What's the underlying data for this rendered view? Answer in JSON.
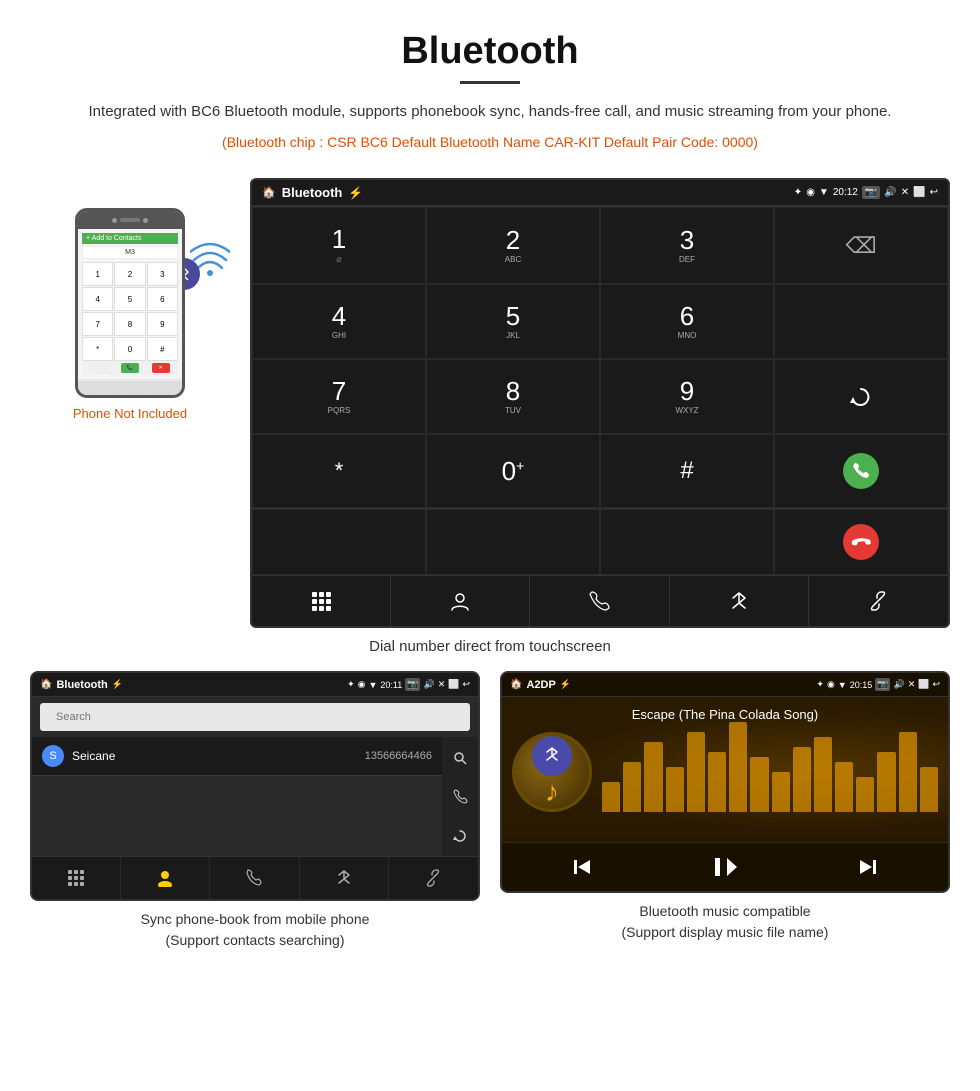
{
  "header": {
    "title": "Bluetooth",
    "description": "Integrated with BC6 Bluetooth module, supports phonebook sync, hands-free call, and music streaming from your phone.",
    "specs": "(Bluetooth chip : CSR BC6    Default Bluetooth Name CAR-KIT    Default Pair Code: 0000)"
  },
  "phone": {
    "not_included_label": "Phone Not Included"
  },
  "dial_screen": {
    "title": "Bluetooth",
    "time": "20:12",
    "keys": [
      {
        "num": "1",
        "sub": ""
      },
      {
        "num": "2",
        "sub": "ABC"
      },
      {
        "num": "3",
        "sub": "DEF"
      },
      {
        "num": "4",
        "sub": "GHI"
      },
      {
        "num": "5",
        "sub": "JKL"
      },
      {
        "num": "6",
        "sub": "MNO"
      },
      {
        "num": "7",
        "sub": "PQRS"
      },
      {
        "num": "8",
        "sub": "TUV"
      },
      {
        "num": "9",
        "sub": "WXYZ"
      },
      {
        "num": "*",
        "sub": ""
      },
      {
        "num": "0",
        "sub": "+"
      },
      {
        "num": "#",
        "sub": ""
      }
    ]
  },
  "dial_caption": "Dial number direct from touchscreen",
  "phonebook_screen": {
    "title": "Bluetooth",
    "time": "20:11",
    "search_placeholder": "Search",
    "contacts": [
      {
        "letter": "S",
        "name": "Seicane",
        "number": "13566664466"
      }
    ]
  },
  "phonebook_caption": "Sync phone-book from mobile phone\n(Support contacts searching)",
  "music_screen": {
    "title": "A2DP",
    "time": "20:15",
    "song_title": "Escape (The Pina Colada Song)",
    "eq_bars": [
      30,
      50,
      70,
      45,
      80,
      60,
      90,
      55,
      40,
      65,
      75,
      50,
      35,
      60,
      80,
      45
    ]
  },
  "music_caption": "Bluetooth music compatible\n(Support display music file name)"
}
